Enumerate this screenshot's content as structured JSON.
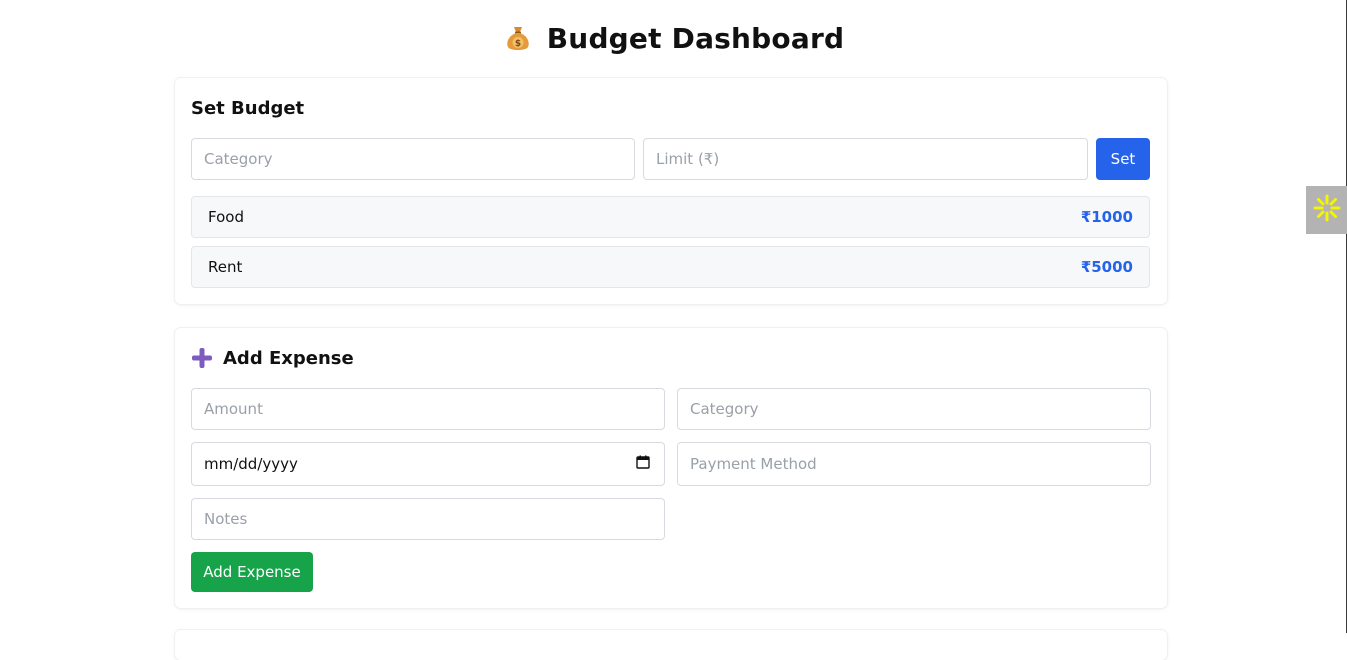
{
  "header": {
    "icon": "money-bag-icon",
    "title": "Budget Dashboard"
  },
  "set_budget": {
    "heading": "Set Budget",
    "category_placeholder": "Category",
    "limit_placeholder": "Limit (₹)",
    "set_label": "Set",
    "items": [
      {
        "name": "Food",
        "amount": "₹1000"
      },
      {
        "name": "Rent",
        "amount": "₹5000"
      }
    ]
  },
  "add_expense": {
    "icon": "plus-icon",
    "heading": "Add Expense",
    "amount_placeholder": "Amount",
    "category_placeholder": "Category",
    "date_value": "mm/dd/yyyy",
    "payment_placeholder": "Payment Method",
    "notes_placeholder": "Notes",
    "submit_label": "Add Expense"
  },
  "side_widget": {
    "icon": "sparkle-icon",
    "accent": "#f5f500"
  },
  "colors": {
    "primary": "#2563eb",
    "success": "#16a34a",
    "plus_icon": "#7c5cbf",
    "money_bag": "#e59a3c"
  }
}
